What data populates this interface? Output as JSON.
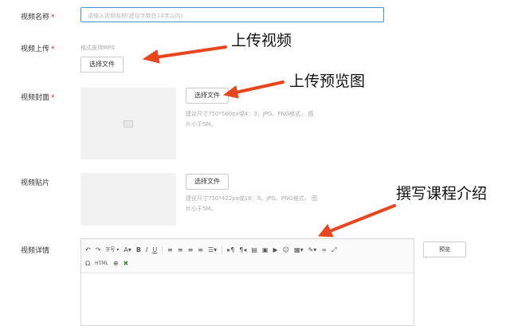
{
  "form": {
    "name_label": "视频名称",
    "name_placeholder": "请输入视频名称(建议字数在14字以内)",
    "upload_label": "视频上传",
    "upload_hint": "格式支持MP4",
    "upload_button": "选择文件",
    "cover_label": "视频封面",
    "cover_button": "选择文件",
    "cover_hint_line1": "建议尺寸750*560px或4：3，JPG、PNG格式， 图",
    "cover_hint_line2": "片小于5M。",
    "patch_label": "视频贴片",
    "patch_button": "选择文件",
    "patch_hint_line1": "建议尺寸750*422px或16：9，JPG、PNG格式， 图",
    "patch_hint_line2": "片小于5M。",
    "details_label": "视频详情",
    "required_mark": "*",
    "preview_button": "预览"
  },
  "editor": {
    "font_size_label": "字号",
    "html_label": "HTML",
    "toolbar_icons": [
      "undo-icon",
      "redo-icon",
      "font-size-dropdown",
      "font-color-icon",
      "bold-icon",
      "italic-icon",
      "underline-icon",
      "align-left-icon",
      "align-center-icon",
      "align-right-icon",
      "align-justify-icon",
      "line-height-icon",
      "ltr-icon",
      "rtl-icon",
      "paragraph-icon",
      "image-icon",
      "video-icon",
      "emoji-icon",
      "insert-image-dropdown",
      "brush-icon",
      "link-icon",
      "fullscreen-icon",
      "special-char-icon",
      "html-source-icon",
      "search-replace-icon",
      "clear-format-icon"
    ]
  },
  "annotations": {
    "upload_video": "上传视频",
    "upload_cover": "上传预览图",
    "write_intro": "撰写课程介绍",
    "arrow_color": "#e8461f"
  }
}
